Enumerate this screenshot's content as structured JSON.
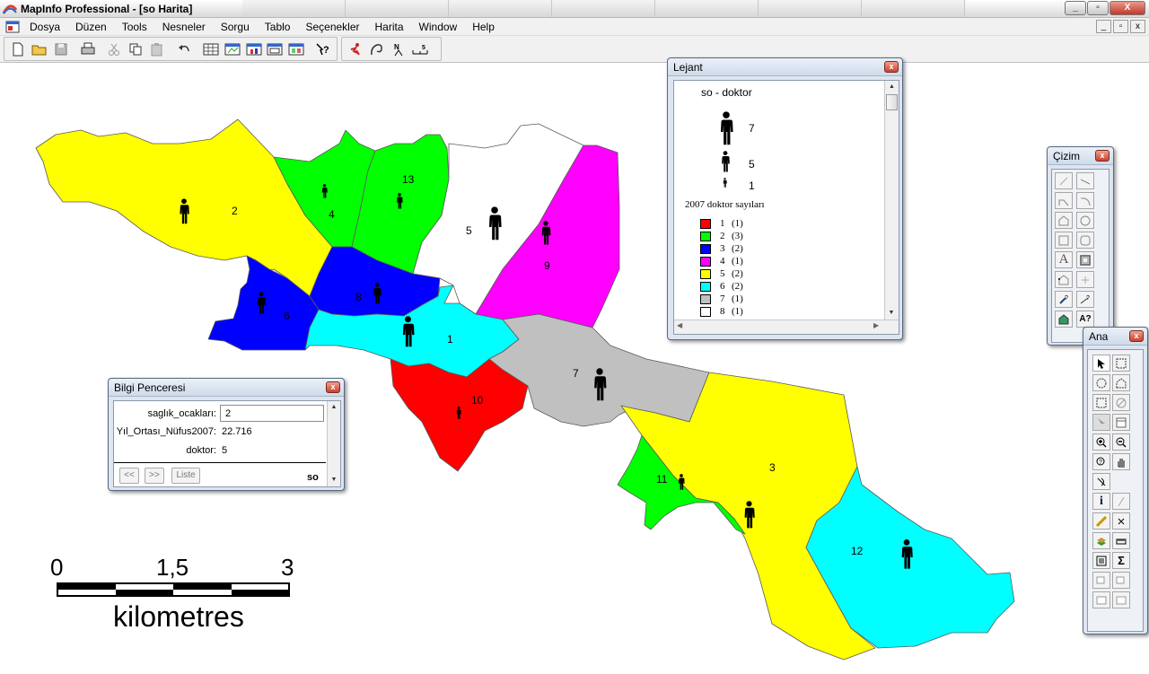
{
  "app": {
    "title": "MapInfo Professional - [so Harita]"
  },
  "menu": {
    "items": [
      "Dosya",
      "Düzen",
      "Tools",
      "Nesneler",
      "Sorgu",
      "Tablo",
      "Seçenekler",
      "Harita",
      "Window",
      "Help"
    ]
  },
  "window_controls": {
    "minimize": "_",
    "restore": "▫",
    "close": "X"
  },
  "toolbar": {
    "icons": [
      "new-icon",
      "open-icon",
      "save-icon",
      "print-icon",
      "cut-icon",
      "copy-icon",
      "paste-icon",
      "undo-icon",
      "browser-icon",
      "map-window-icon",
      "graph-icon",
      "layout-icon",
      "redistrict-icon",
      "help-icon",
      "runner-icon",
      "hotlink-icon",
      "north-arrow-icon",
      "scalebar-icon"
    ]
  },
  "map": {
    "regions": [
      {
        "id": "2",
        "color": "#ffff00"
      },
      {
        "id": "4",
        "color": "#00ff00"
      },
      {
        "id": "13",
        "color": "#00ff00"
      },
      {
        "id": "5",
        "color": "#ffffff"
      },
      {
        "id": "9",
        "color": "#ff00ff"
      },
      {
        "id": "6",
        "color": "#0000ff"
      },
      {
        "id": "8",
        "color": "#0000ff"
      },
      {
        "id": "1",
        "color": "#00ffff"
      },
      {
        "id": "7",
        "color": "#c0c0c0"
      },
      {
        "id": "10",
        "color": "#ff0000"
      },
      {
        "id": "11",
        "color": "#00ff00"
      },
      {
        "id": "3",
        "color": "#ffff00"
      },
      {
        "id": "12",
        "color": "#00ffff"
      }
    ],
    "scalebar": {
      "ticks": [
        "0",
        "1,5",
        "3"
      ],
      "unit": "kilometres"
    }
  },
  "legend_window": {
    "title": "Lejant",
    "layer_title": "so - doktor",
    "symbol_values": [
      "7",
      "5",
      "1"
    ],
    "theme_title": "2007 doktor sayıları",
    "classes": [
      {
        "label": "1",
        "count": "(1)",
        "color": "#ff0000"
      },
      {
        "label": "2",
        "count": "(3)",
        "color": "#00ff00"
      },
      {
        "label": "3",
        "count": "(2)",
        "color": "#0000ff"
      },
      {
        "label": "4",
        "count": "(1)",
        "color": "#ff00ff"
      },
      {
        "label": "5",
        "count": "(2)",
        "color": "#ffff00"
      },
      {
        "label": "6",
        "count": "(2)",
        "color": "#00ffff"
      },
      {
        "label": "7",
        "count": "(1)",
        "color": "#c0c0c0"
      },
      {
        "label": "8",
        "count": "(1)",
        "color": "#ffffff"
      }
    ]
  },
  "drawing_toolbar": {
    "title": "Çizim"
  },
  "main_toolbar": {
    "title": "Ana"
  },
  "info_window": {
    "title": "Bilgi Penceresi",
    "fields": [
      {
        "label": "saglık_ocakları:",
        "value": "2"
      },
      {
        "label": "Yıl_Ortası_Nüfus2007:",
        "value": "22.716"
      },
      {
        "label": "doktor:",
        "value": "5"
      }
    ],
    "prev_label": "<<",
    "next_label": ">>",
    "list_label": "Liste",
    "table_name": "so"
  }
}
